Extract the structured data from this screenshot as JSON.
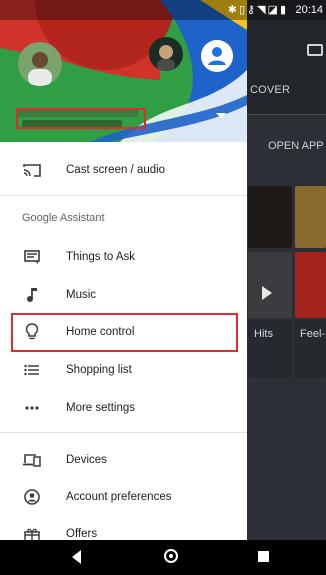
{
  "status_bar": {
    "time": "20:14",
    "icons": [
      "bluetooth-icon",
      "vibrate-icon",
      "vpn-key-icon",
      "wifi-icon",
      "no-sim-icon",
      "battery-icon"
    ]
  },
  "drawer": {
    "section_title": "Google Assistant",
    "items": [
      {
        "label": "Cast screen / audio",
        "icon": "cast-icon"
      },
      {
        "label": "Things to Ask",
        "icon": "chat-list-icon"
      },
      {
        "label": "Music",
        "icon": "music-note-icon"
      },
      {
        "label": "Home control",
        "icon": "lightbulb-icon"
      },
      {
        "label": "Shopping list",
        "icon": "list-icon"
      },
      {
        "label": "More settings",
        "icon": "more-dots-icon"
      },
      {
        "label": "Devices",
        "icon": "devices-icon"
      },
      {
        "label": "Account preferences",
        "icon": "account-circle-icon"
      },
      {
        "label": "Offers",
        "icon": "gift-icon"
      }
    ]
  },
  "background_app": {
    "tab_label": "COVER",
    "open_app_label": "OPEN APP",
    "tile_labels": [
      "Hits",
      "Feel-"
    ]
  },
  "colors": {
    "highlight": "#e32b2b",
    "header_red": "#d1332b",
    "header_green": "#2f9e44",
    "header_blue": "#1e63c9",
    "header_yellow": "#f5c518"
  }
}
